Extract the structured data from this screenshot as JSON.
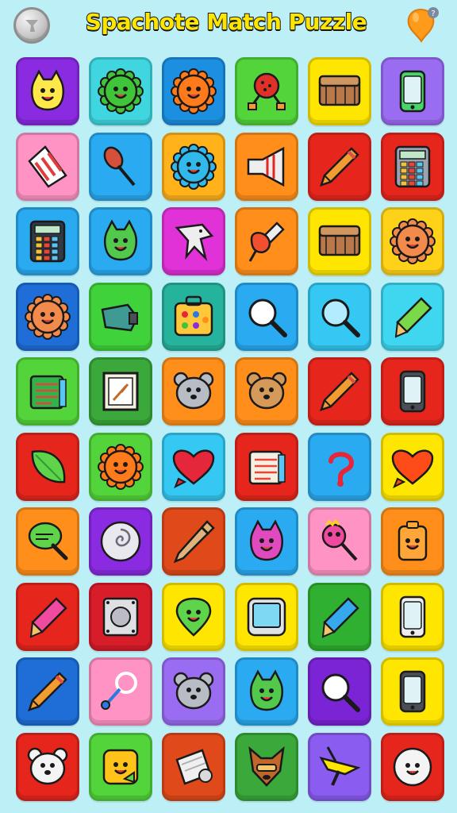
{
  "header": {
    "title": "Spachote Match Puzzle",
    "left_icon": "silver-coin-icon",
    "right_icon": "orange-balloon-hint-icon",
    "accent_title": "#ffe600"
  },
  "board": {
    "columns": 6,
    "rows": 10,
    "tiles": [
      {
        "icon": "cat-face",
        "color": "#8a2be2",
        "c1": "#ffe94a"
      },
      {
        "icon": "sun-face",
        "color": "#3fd6e0",
        "c1": "#3fc43a"
      },
      {
        "icon": "sun-face",
        "color": "#1d8fe0",
        "c1": "#ff7a1a"
      },
      {
        "icon": "ball",
        "color": "#53d43a",
        "c1": "#e0302a"
      },
      {
        "icon": "chest",
        "color": "#ffe600",
        "c1": "#b8784a"
      },
      {
        "icon": "phone",
        "color": "#9a6cf2",
        "c1": "#49d36a"
      },
      {
        "icon": "card",
        "color": "#ff93c4",
        "c1": "#e03c3c"
      },
      {
        "icon": "maraca",
        "color": "#2aaaf0",
        "c1": "#d4503a"
      },
      {
        "icon": "sun-face",
        "color": "#ffb21a",
        "c1": "#30b9ea"
      },
      {
        "icon": "horn",
        "color": "#ff8f1a",
        "c1": "#eeeeee"
      },
      {
        "icon": "pencil",
        "color": "#e6261d",
        "c1": "#f29b30"
      },
      {
        "icon": "calculator",
        "color": "#e6261d",
        "c1": "#9aa3b0"
      },
      {
        "icon": "calculator",
        "color": "#2aaaf0",
        "c1": "#2e3a48"
      },
      {
        "icon": "cat-face",
        "color": "#2aaaf0",
        "c1": "#52c94c"
      },
      {
        "icon": "shark",
        "color": "#e032d6",
        "c1": "#eeeeee"
      },
      {
        "icon": "pin",
        "color": "#ff8f1a",
        "c1": "#f0502e"
      },
      {
        "icon": "chest",
        "color": "#ffe600",
        "c1": "#b8784a"
      },
      {
        "icon": "sun-face",
        "color": "#ffd21a",
        "c1": "#f18a4a"
      },
      {
        "icon": "sun-face",
        "color": "#1f6ed8",
        "c1": "#f18a4a"
      },
      {
        "icon": "sharpener",
        "color": "#3fd23a",
        "c1": "#3e9a92"
      },
      {
        "icon": "case",
        "color": "#26b39e",
        "c1": "#ffc83a"
      },
      {
        "icon": "magnifier",
        "color": "#2aaaf0",
        "c1": "#ffffff"
      },
      {
        "icon": "magnifier",
        "color": "#34c8f2",
        "c1": "#b4ecff"
      },
      {
        "icon": "marker",
        "color": "#3fd6f0",
        "c1": "#79d94a"
      },
      {
        "icon": "notes",
        "color": "#53d43a",
        "c1": "#2fb34a"
      },
      {
        "icon": "frame",
        "color": "#3aa83a",
        "c1": "#f4efe0"
      },
      {
        "icon": "bear-face",
        "color": "#ff8f1a",
        "c1": "#b8bcc4"
      },
      {
        "icon": "bear-face",
        "color": "#ff8f1a",
        "c1": "#d59a5a"
      },
      {
        "icon": "pencil",
        "color": "#e6261d",
        "c1": "#f29b30"
      },
      {
        "icon": "phone",
        "color": "#e6261d",
        "c1": "#4a4f56"
      },
      {
        "icon": "leaf",
        "color": "#e6261d",
        "c1": "#5fd44a"
      },
      {
        "icon": "sun-face",
        "color": "#53d43a",
        "c1": "#ff7a1a"
      },
      {
        "icon": "heart",
        "color": "#34c8f2",
        "c1": "#e6263a"
      },
      {
        "icon": "notes",
        "color": "#e6261d",
        "c1": "#f4efe0"
      },
      {
        "icon": "hook",
        "color": "#2aaaf0",
        "c1": "#e6263a"
      },
      {
        "icon": "heart",
        "color": "#ffe600",
        "c1": "#ff4a1a"
      },
      {
        "icon": "paddle",
        "color": "#ff8f1a",
        "c1": "#5fd44a"
      },
      {
        "icon": "disc",
        "color": "#8a2be2",
        "c1": "#e8e8ee"
      },
      {
        "icon": "pen",
        "color": "#e04a1a",
        "c1": "#dfb47a"
      },
      {
        "icon": "cat-face",
        "color": "#2aaaf0",
        "c1": "#e04abf"
      },
      {
        "icon": "lollipop",
        "color": "#ff93c4",
        "c1": "#f04aa0"
      },
      {
        "icon": "tag",
        "color": "#ff8f1a",
        "c1": "#ffa63a"
      },
      {
        "icon": "marker",
        "color": "#e6261d",
        "c1": "#f04aa0"
      },
      {
        "icon": "button-panel",
        "color": "#d81d2a",
        "c1": "#dfe0e4"
      },
      {
        "icon": "drop-face",
        "color": "#ffe600",
        "c1": "#5fd44a"
      },
      {
        "icon": "screen",
        "color": "#ffe600",
        "c1": "#7ed8f4"
      },
      {
        "icon": "marker",
        "color": "#2fb030",
        "c1": "#37a8ee"
      },
      {
        "icon": "phone",
        "color": "#ffe600",
        "c1": "#eeeeee"
      },
      {
        "icon": "pencil",
        "color": "#1f6ed8",
        "c1": "#f29b30"
      },
      {
        "icon": "rattle",
        "color": "#ff93c4",
        "c1": "#ffffff"
      },
      {
        "icon": "bear-face",
        "color": "#9a6cf2",
        "c1": "#b8bcc4"
      },
      {
        "icon": "cat-face",
        "color": "#2aaaf0",
        "c1": "#52c94c"
      },
      {
        "icon": "magnifier",
        "color": "#7a24d6",
        "c1": "#ffffff"
      },
      {
        "icon": "phone",
        "color": "#ffe600",
        "c1": "#4a4f56"
      },
      {
        "icon": "bear-face",
        "color": "#e6261d",
        "c1": "#f4f4f4"
      },
      {
        "icon": "square-face",
        "color": "#53d43a",
        "c1": "#ffc31a"
      },
      {
        "icon": "scroll",
        "color": "#e04a1a",
        "c1": "#f0f0f0"
      },
      {
        "icon": "fox-face",
        "color": "#3aa83a",
        "c1": "#c2662a"
      },
      {
        "icon": "top",
        "color": "#8a5cf0",
        "c1": "#ffe600"
      },
      {
        "icon": "ball-face",
        "color": "#e6261d",
        "c1": "#f4f4f4"
      }
    ]
  }
}
